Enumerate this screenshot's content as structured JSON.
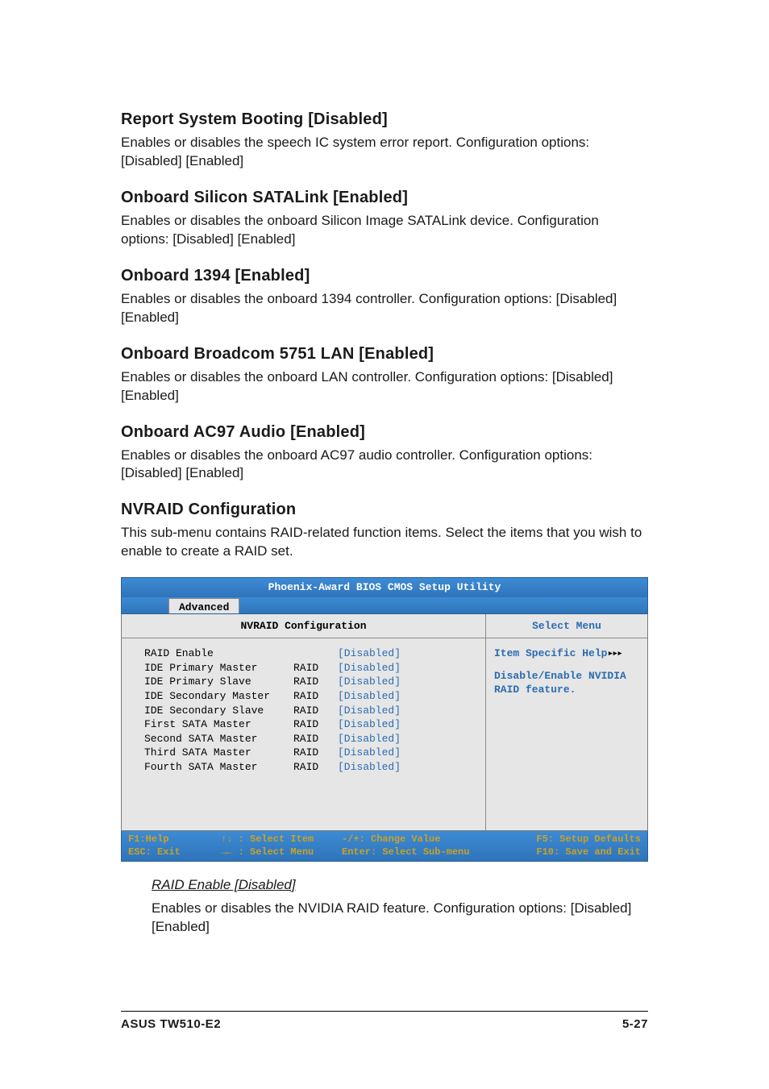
{
  "sections": [
    {
      "title": "Report System Booting [Disabled]",
      "body": "Enables or disables the speech IC system error report. Configuration options: [Disabled] [Enabled]"
    },
    {
      "title": "Onboard Silicon SATALink [Enabled]",
      "body": "Enables or disables the onboard Silicon Image SATALink device. Configuration options: [Disabled] [Enabled]"
    },
    {
      "title": "Onboard 1394 [Enabled]",
      "body": "Enables or disables the onboard 1394 controller. Configuration options: [Disabled] [Enabled]"
    },
    {
      "title": "Onboard Broadcom 5751 LAN [Enabled]",
      "body": "Enables or disables the onboard LAN controller. Configuration options: [Disabled] [Enabled]"
    },
    {
      "title": "Onboard AC97 Audio [Enabled]",
      "body": "Enables or disables the onboard AC97 audio controller. Configuration options: [Disabled] [Enabled]"
    },
    {
      "title": "NVRAID Configuration",
      "body": "This sub-menu contains RAID-related function items. Select the items that you wish to enable to create a RAID set."
    }
  ],
  "bios": {
    "header": "Phoenix-Award BIOS CMOS Setup Utility",
    "tab": "Advanced",
    "left_title": "NVRAID Configuration",
    "right_title": "Select Menu",
    "help_heading": "Item Specific Help",
    "help_arrows": "▸▸▸",
    "help_body": "Disable/Enable NVIDIA RAID feature.",
    "rows": [
      {
        "label": "RAID Enable",
        "type": "",
        "val": "[Disabled]"
      },
      {
        "label": "IDE Primary Master",
        "type": "RAID",
        "val": "[Disabled]"
      },
      {
        "label": "IDE Primary Slave",
        "type": "RAID",
        "val": "[Disabled]"
      },
      {
        "label": "IDE Secondary Master",
        "type": "RAID",
        "val": "[Disabled]"
      },
      {
        "label": "IDE Secondary Slave",
        "type": "RAID",
        "val": "[Disabled]"
      },
      {
        "label": "First SATA Master",
        "type": "RAID",
        "val": "[Disabled]"
      },
      {
        "label": "Second SATA Master",
        "type": "RAID",
        "val": "[Disabled]"
      },
      {
        "label": "Third SATA Master",
        "type": "RAID",
        "val": "[Disabled]"
      },
      {
        "label": "Fourth SATA Master",
        "type": "RAID",
        "val": "[Disabled]"
      }
    ],
    "footer": {
      "f1": "F1:Help",
      "updown": "↑↓ : Select Item",
      "plusminus": "-/+: Change Value",
      "f5": "F5: Setup Defaults",
      "esc": "ESC: Exit",
      "leftright": "→← : Select Menu",
      "enter": "Enter: Select Sub-menu",
      "f10": "F10: Save and Exit"
    }
  },
  "subitem": {
    "title": "RAID Enable [Disabled]",
    "body": "Enables or disables the NVIDIA RAID feature. Configuration options: [Disabled] [Enabled]"
  },
  "footer": {
    "left": "ASUS TW510-E2",
    "right": "5-27"
  }
}
